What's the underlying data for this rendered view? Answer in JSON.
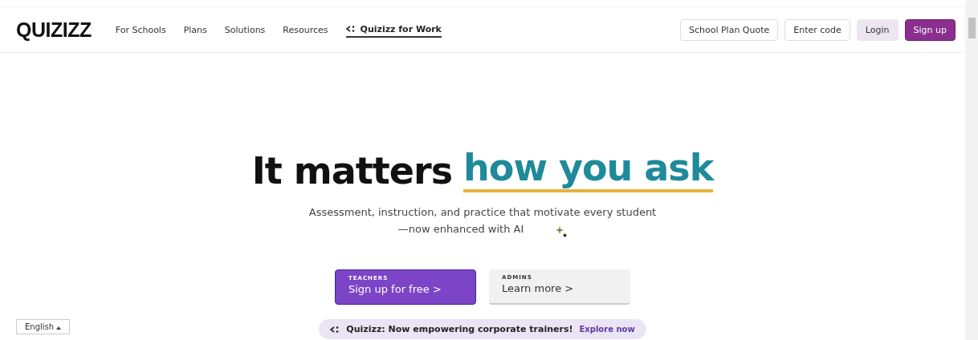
{
  "nav": {
    "logo": "QUIZIZZ",
    "links": [
      "For Schools",
      "Plans",
      "Solutions",
      "Resources"
    ],
    "work_link": "Quizizz for Work",
    "buttons": [
      {
        "label": "School Plan Quote",
        "kind": "outline"
      },
      {
        "label": "Enter code",
        "kind": "outline"
      },
      {
        "label": "Login",
        "kind": "soft"
      },
      {
        "label": "Sign up",
        "kind": "primary"
      }
    ]
  },
  "hero": {
    "title": "It matters",
    "title_highlight": "how you ask",
    "subtitle_1": "Assessment, instruction, and practice that motivate every student",
    "subtitle_2": "—now enhanced with AI"
  },
  "ctas": [
    {
      "eyebrow": "TEACHERS",
      "label": "Sign up for free >",
      "kind": "primary"
    },
    {
      "eyebrow": "ADMINS",
      "label": "Learn more >",
      "kind": "secondary"
    }
  ],
  "banner": {
    "text": "Quizizz: Now empowering corporate trainers!",
    "link": "Explore now"
  },
  "language": {
    "value": "English"
  }
}
